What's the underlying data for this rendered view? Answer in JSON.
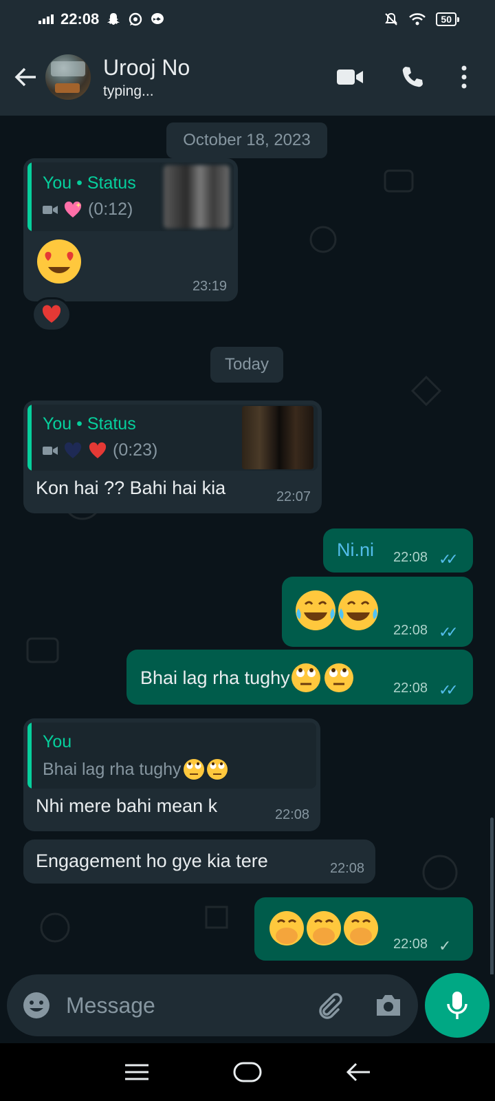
{
  "status_bar": {
    "time": "22:08",
    "battery": "50"
  },
  "header": {
    "contact_name": "Urooj No",
    "contact_status": "typing..."
  },
  "messages": {
    "date1": "October 18, 2023",
    "m1": {
      "quote_title": "You • Status",
      "quote_duration": "(0:12)",
      "time": "23:19",
      "reaction": "heart"
    },
    "date2": "Today",
    "m2": {
      "quote_title": "You • Status",
      "quote_duration": "(0:23)",
      "text": "Kon hai ?? Bahi hai kia",
      "time": "22:07"
    },
    "m3": {
      "text": "Ni.ni",
      "time": "22:08"
    },
    "m4": {
      "time": "22:08"
    },
    "m5": {
      "text": "Bhai lag rha tughy",
      "time": "22:08"
    },
    "m6": {
      "quote_title": "You",
      "quote_text": "Bhai lag rha tughy",
      "text": "Nhi mere bahi mean k",
      "time": "22:08"
    },
    "m7": {
      "text": "Engagement ho gye kia tere",
      "time": "22:08"
    },
    "m8": {
      "time": "22:08"
    }
  },
  "input": {
    "placeholder": "Message"
  },
  "colors": {
    "accent": "#00a884",
    "outgoing": "#005c4b",
    "incoming": "#1f2c34",
    "read_ticks": "#53bdeb"
  }
}
